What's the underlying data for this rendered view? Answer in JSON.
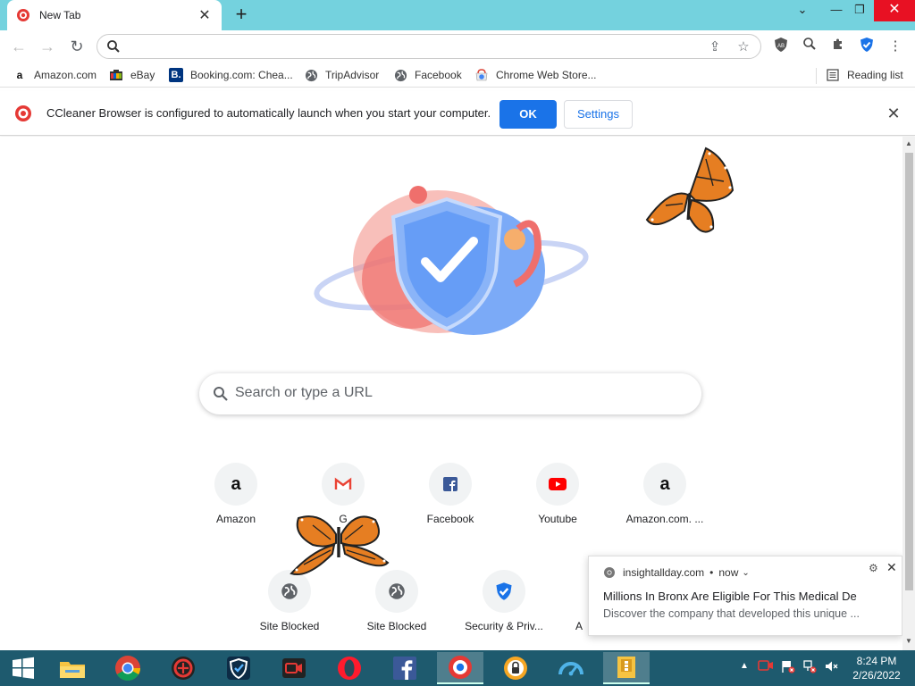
{
  "tab": {
    "title": "New Tab"
  },
  "window": {
    "newtab_label": "+",
    "minimize": "—",
    "restore": "❐",
    "close": "✕",
    "dropdown": "⌄"
  },
  "toolbar": {
    "back": "←",
    "forward": "→",
    "reload": "↻",
    "address_value": ""
  },
  "bookmarks": [
    {
      "label": "Amazon.com",
      "icon": "amazon-icon"
    },
    {
      "label": "eBay",
      "icon": "ebay-icon"
    },
    {
      "label": "Booking.com: Chea...",
      "icon": "booking-icon"
    },
    {
      "label": "TripAdvisor",
      "icon": "globe-icon"
    },
    {
      "label": "Facebook",
      "icon": "globe-icon"
    },
    {
      "label": "Chrome Web Store...",
      "icon": "webstore-icon"
    }
  ],
  "reading_list": "Reading list",
  "infobar": {
    "message": "CCleaner Browser is configured to automatically launch when you start your computer.",
    "ok": "OK",
    "settings": "Settings"
  },
  "ntp": {
    "search_placeholder": "Search or type a URL",
    "tiles_row1": [
      {
        "label": "Amazon",
        "icon": "amazon-icon"
      },
      {
        "label": "G",
        "icon": "gmail-icon"
      },
      {
        "label": "Facebook",
        "icon": "facebook-icon"
      },
      {
        "label": "Youtube",
        "icon": "youtube-icon"
      },
      {
        "label": "Amazon.com. ...",
        "icon": "amazon-icon"
      }
    ],
    "tiles_row2": [
      {
        "label": "Site Blocked",
        "icon": "globe-icon"
      },
      {
        "label": "Site Blocked",
        "icon": "globe-icon"
      },
      {
        "label": "Security & Priv...",
        "icon": "shield-icon"
      },
      {
        "label": "A",
        "icon": "unknown-icon"
      }
    ]
  },
  "notification": {
    "source": "insightallday.com",
    "time": "now",
    "title": "Millions In Bronx Are Eligible For This Medical De",
    "body": "Discover the company that developed this unique ..."
  },
  "taskbar": {
    "time": "8:24 PM",
    "date": "2/26/2022"
  },
  "colors": {
    "tabstrip": "#74d2de",
    "accent": "#1a73e8",
    "taskbar": "#1e5a6e"
  }
}
